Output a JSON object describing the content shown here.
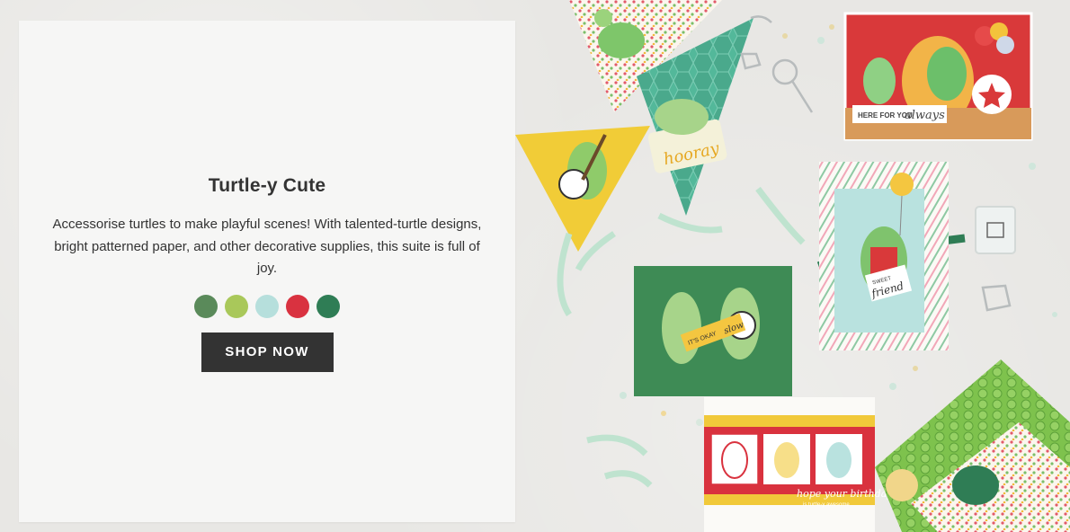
{
  "promo": {
    "title": "Turtle-y Cute",
    "description": "Accessorise turtles to make playful scenes! With talented-turtle designs, bright patterned paper, and other decorative supplies, this suite is full of joy.",
    "swatches": [
      {
        "name": "green-swatch",
        "color": "#5a8a5a"
      },
      {
        "name": "lime-swatch",
        "color": "#a9c85a"
      },
      {
        "name": "mint-swatch",
        "color": "#b6dfdc"
      },
      {
        "name": "red-swatch",
        "color": "#d93240"
      },
      {
        "name": "dark-green-swatch",
        "color": "#2f7d55"
      }
    ],
    "button_label": "SHOP NOW"
  },
  "art": {
    "card_texts": {
      "hooray": "hooray",
      "here_for_you": "HERE FOR YOU",
      "always": "always",
      "sweet": "SWEET",
      "friend": "friend",
      "hope": "hope your birthday",
      "awesome": "is turtle-y awesome",
      "its_okay": "IT'S OKAY",
      "slow": "slow"
    }
  }
}
